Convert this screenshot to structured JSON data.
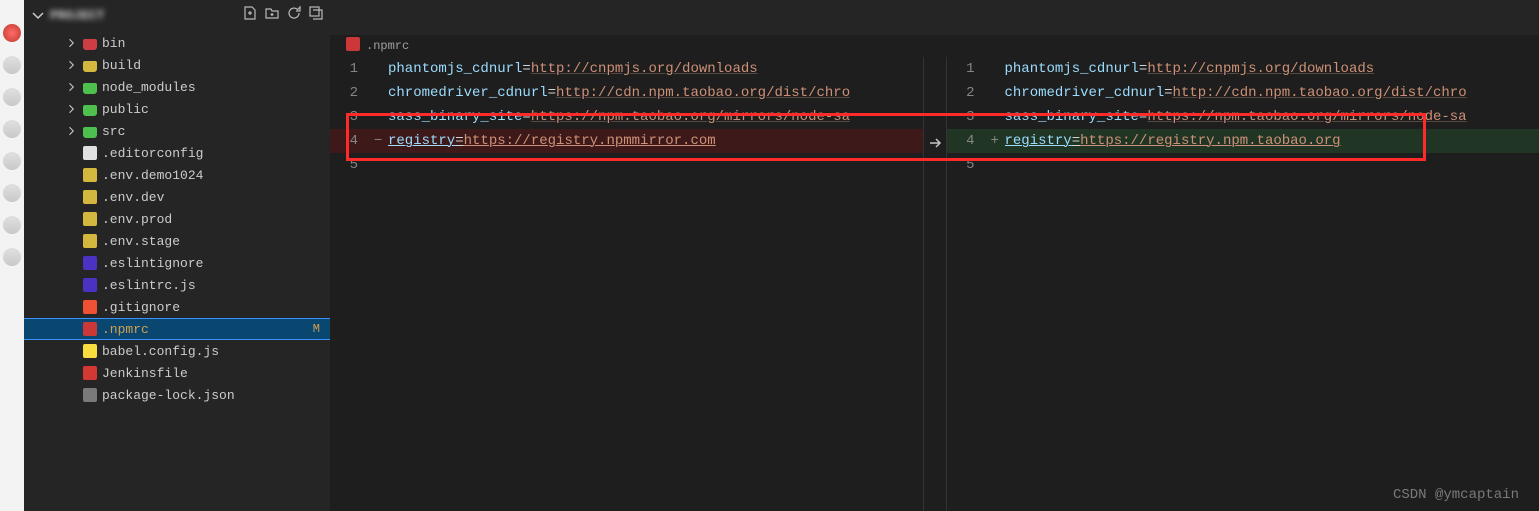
{
  "explorer": {
    "project_label": "PROJECT",
    "items": [
      {
        "name": "bin",
        "type": "folder",
        "icon": "folder-red"
      },
      {
        "name": "build",
        "type": "folder",
        "icon": "folder-yellow"
      },
      {
        "name": "node_modules",
        "type": "folder",
        "icon": "folder-green"
      },
      {
        "name": "public",
        "type": "folder",
        "icon": "folder-green"
      },
      {
        "name": "src",
        "type": "folder",
        "icon": "folder-green"
      },
      {
        "name": ".editorconfig",
        "type": "file",
        "icon": "editorconfig"
      },
      {
        "name": ".env.demo1024",
        "type": "file",
        "icon": "env"
      },
      {
        "name": ".env.dev",
        "type": "file",
        "icon": "env"
      },
      {
        "name": ".env.prod",
        "type": "file",
        "icon": "env"
      },
      {
        "name": ".env.stage",
        "type": "file",
        "icon": "env"
      },
      {
        "name": ".eslintignore",
        "type": "file",
        "icon": "eslint"
      },
      {
        "name": ".eslintrc.js",
        "type": "file",
        "icon": "eslint"
      },
      {
        "name": ".gitignore",
        "type": "file",
        "icon": "git"
      },
      {
        "name": ".npmrc",
        "type": "file",
        "icon": "npm",
        "selected": true,
        "badge": "M"
      },
      {
        "name": "babel.config.js",
        "type": "file",
        "icon": "babel"
      },
      {
        "name": "Jenkinsfile",
        "type": "file",
        "icon": "jenkins"
      },
      {
        "name": "package-lock.json",
        "type": "file",
        "icon": "npm-lock"
      }
    ]
  },
  "breadcrumb": {
    "filename": ".npmrc"
  },
  "diff": {
    "left": {
      "lines": [
        {
          "num": "1",
          "key": "phantomjs_cdnurl",
          "url": "http://cnpmjs.org/downloads"
        },
        {
          "num": "2",
          "key": "chromedriver_cdnurl",
          "url": "http://cdn.npm.taobao.org/dist/chro"
        },
        {
          "num": "3",
          "key": "sass_binary_site",
          "url": "https://npm.taobao.org/mirrors/node-sa"
        },
        {
          "num": "4",
          "key": "registry",
          "url": "https://registry.npmmirror.com",
          "deleted": true
        },
        {
          "num": "5",
          "key": "",
          "url": ""
        }
      ]
    },
    "right": {
      "lines": [
        {
          "num": "1",
          "key": "phantomjs_cdnurl",
          "url": "http://cnpmjs.org/downloads"
        },
        {
          "num": "2",
          "key": "chromedriver_cdnurl",
          "url": "http://cdn.npm.taobao.org/dist/chro"
        },
        {
          "num": "3",
          "key": "sass_binary_site",
          "url": "https://npm.taobao.org/mirrors/node-sa"
        },
        {
          "num": "4",
          "key": "registry",
          "url": "https://registry.npm.taobao.org",
          "added": true
        },
        {
          "num": "5",
          "key": "",
          "url": ""
        }
      ]
    }
  },
  "watermark": "CSDN @ymcaptain"
}
